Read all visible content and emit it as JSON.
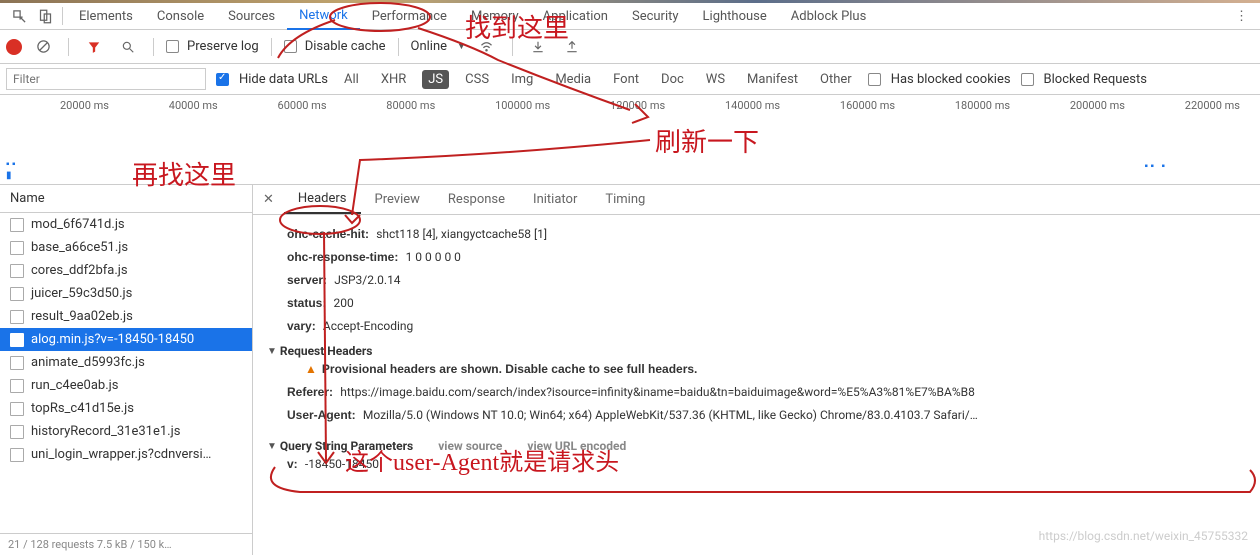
{
  "tabs": {
    "elements": "Elements",
    "console": "Console",
    "sources": "Sources",
    "network": "Network",
    "performance": "Performance",
    "memory": "Memory",
    "application": "Application",
    "security": "Security",
    "lighthouse": "Lighthouse",
    "adblock": "Adblock Plus"
  },
  "toolbar": {
    "preserve_log": "Preserve log",
    "disable_cache": "Disable cache",
    "online": "Online"
  },
  "filter": {
    "placeholder": "Filter",
    "hide_urls": "Hide data URLs",
    "all": "All",
    "xhr": "XHR",
    "js": "JS",
    "css": "CSS",
    "img": "Img",
    "media": "Media",
    "font": "Font",
    "doc": "Doc",
    "ws": "WS",
    "manifest": "Manifest",
    "other": "Other",
    "blocked_cookies": "Has blocked cookies",
    "blocked_requests": "Blocked Requests"
  },
  "timeline": {
    "labels": [
      "20000 ms",
      "40000 ms",
      "60000 ms",
      "80000 ms",
      "100000 ms",
      "120000 ms",
      "140000 ms",
      "160000 ms",
      "180000 ms",
      "200000 ms",
      "220000 ms"
    ]
  },
  "sidebar": {
    "title": "Name",
    "files": [
      {
        "name": "mod_6f6741d.js",
        "sel": false
      },
      {
        "name": "base_a66ce51.js",
        "sel": false
      },
      {
        "name": "cores_ddf2bfa.js",
        "sel": false
      },
      {
        "name": "juicer_59c3d50.js",
        "sel": false
      },
      {
        "name": "result_9aa02eb.js",
        "sel": false
      },
      {
        "name": "alog.min.js?v=-18450-18450",
        "sel": true
      },
      {
        "name": "animate_d5993fc.js",
        "sel": false
      },
      {
        "name": "run_c4ee0ab.js",
        "sel": false
      },
      {
        "name": "topRs_c41d15e.js",
        "sel": false
      },
      {
        "name": "historyRecord_31e31e1.js",
        "sel": false
      },
      {
        "name": "uni_login_wrapper.js?cdnversi…",
        "sel": false
      }
    ],
    "status": "21 / 128 requests   7.5 kB / 150 k…"
  },
  "detail_tabs": {
    "headers": "Headers",
    "preview": "Preview",
    "response": "Response",
    "initiator": "Initiator",
    "timing": "Timing"
  },
  "headers": {
    "ohc_cache_hit_k": "ohc-cache-hit:",
    "ohc_cache_hit_v": "shct118 [4], xiangyctcache58 [1]",
    "ohc_resp_time_k": "ohc-response-time:",
    "ohc_resp_time_v": "1 0 0 0 0 0",
    "server_k": "server:",
    "server_v": "JSP3/2.0.14",
    "status_k": "status:",
    "status_v": "200",
    "vary_k": "vary:",
    "vary_v": "Accept-Encoding",
    "req_title": "Request Headers",
    "prov_warn": "Provisional headers are shown. Disable cache to see full headers.",
    "referer_k": "Referer:",
    "referer_v": "https://image.baidu.com/search/index?isource=infinity&iname=baidu&tn=baiduimage&word=%E5%A3%81%E7%BA%B8",
    "ua_k": "User-Agent:",
    "ua_v": "Mozilla/5.0 (Windows NT 10.0; Win64; x64) AppleWebKit/537.36 (KHTML, like Gecko) Chrome/83.0.4103.7 Safari/…",
    "qsp_title": "Query String Parameters",
    "view_source": "view source",
    "view_url": "view URL encoded",
    "v_k": "v:",
    "v_v": "-18450-18450"
  },
  "annotations": {
    "a1": "找到这里",
    "a2": "刷新一下",
    "a3": "再找这里",
    "a4": "这个user-Agent就是请求头"
  },
  "watermark": "https://blog.csdn.net/weixin_45755332"
}
